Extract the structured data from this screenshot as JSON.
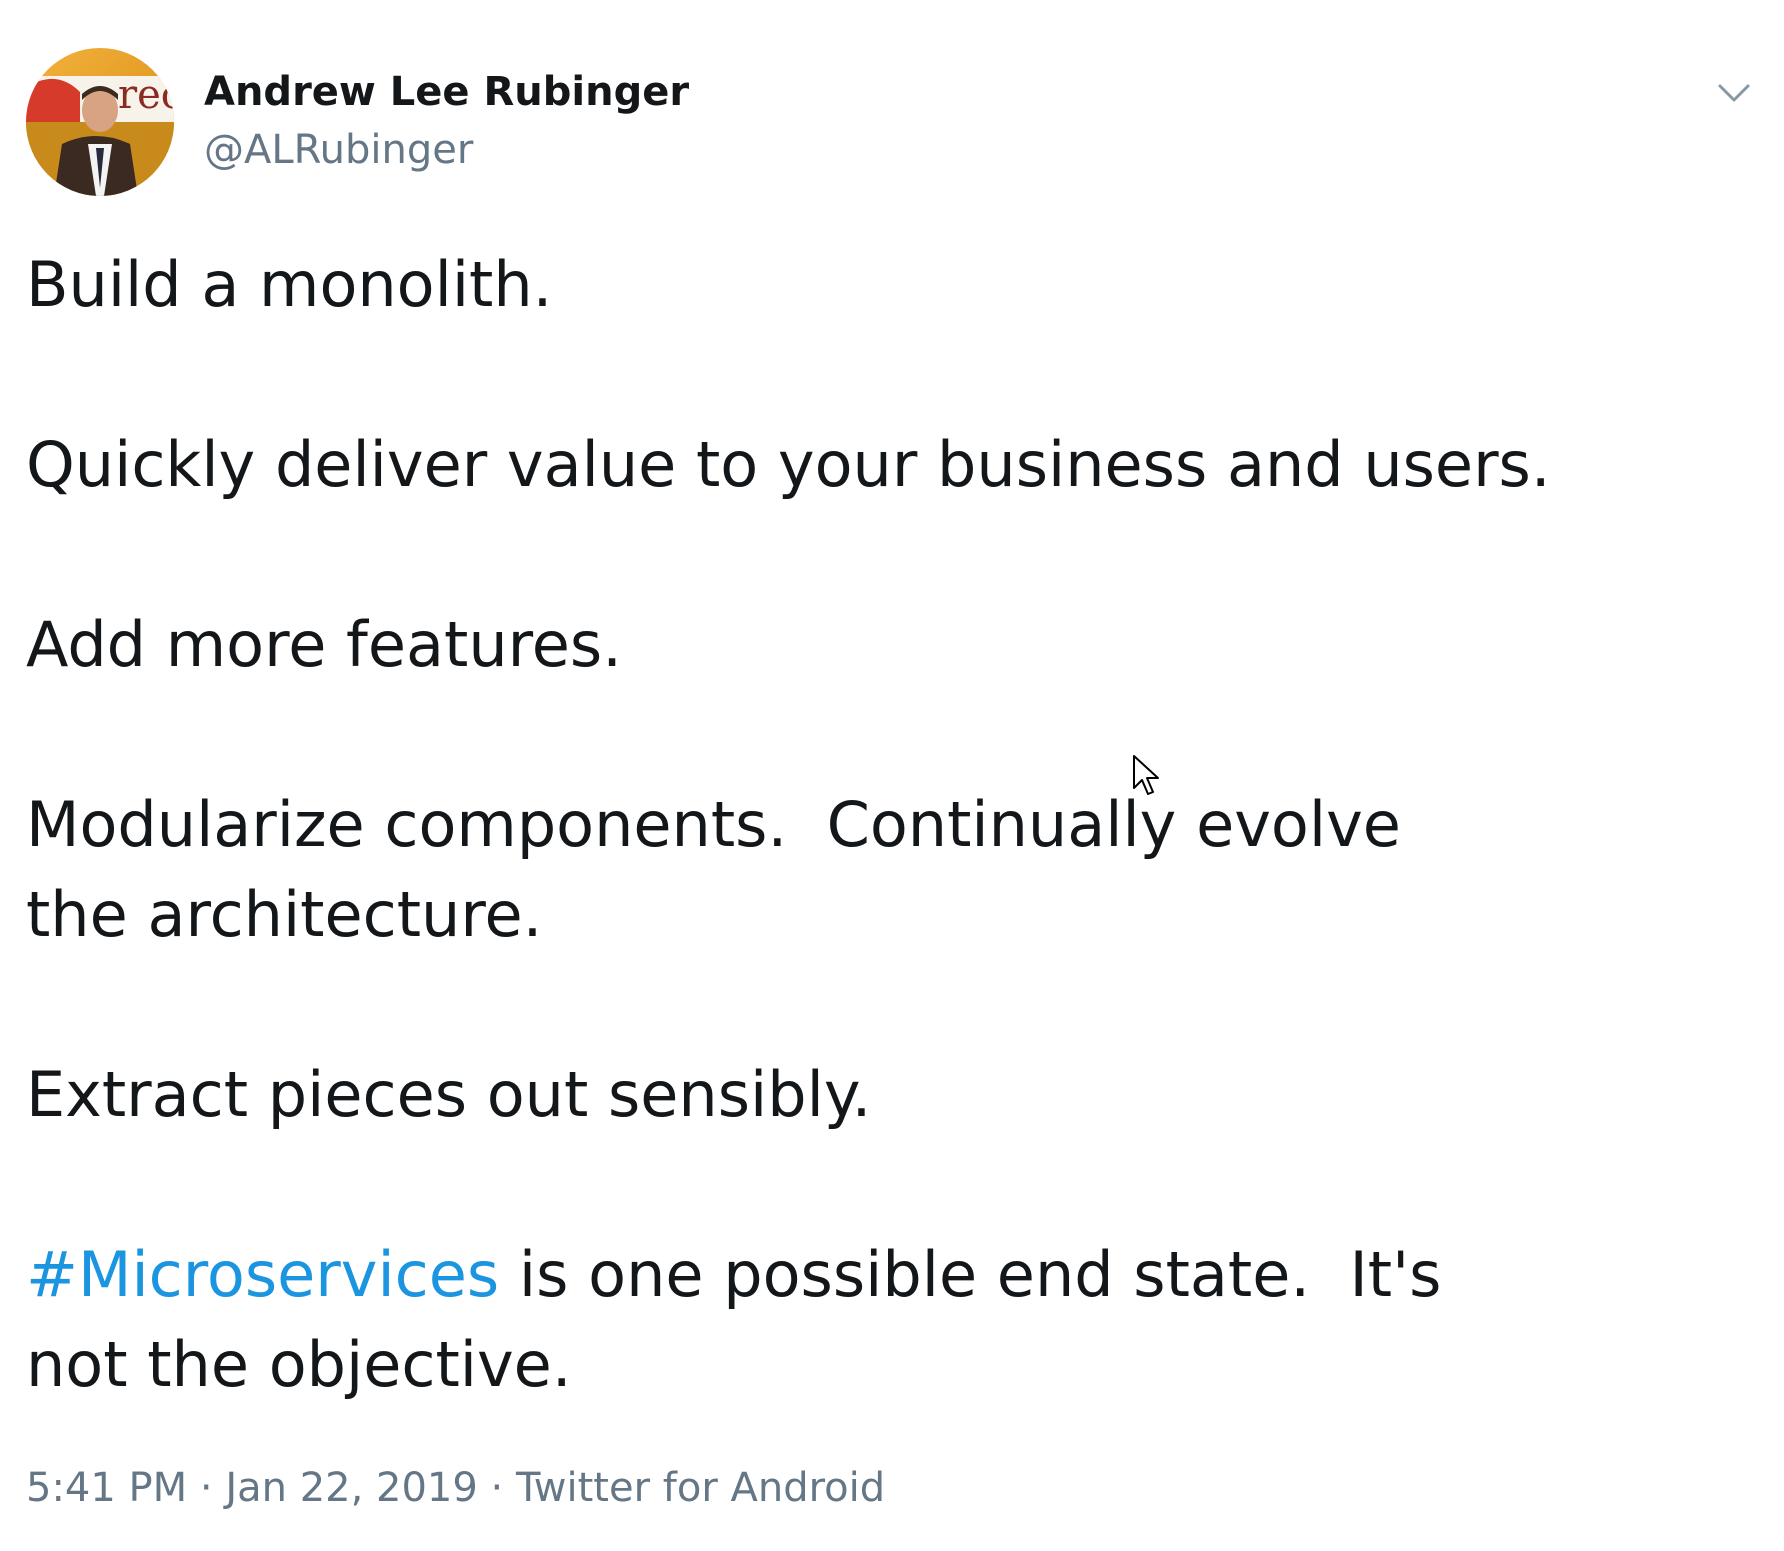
{
  "author": {
    "display_name": "Andrew Lee Rubinger",
    "handle": "@ALRubinger",
    "avatar_icon": "profile-photo"
  },
  "menu": {
    "caret_icon": "chevron-down-icon"
  },
  "tweet": {
    "paragraphs": [
      "Build a monolith.",
      "Quickly deliver value to your business and users.",
      "Add more features.",
      "Modularize components.  Continually evolve the architecture.",
      "Extract pieces out sensibly."
    ],
    "hashtag": "#Microservices",
    "last_paragraph_rest": " is one possible end state.  It's not the objective."
  },
  "meta": {
    "time": "5:41 PM",
    "separator": " · ",
    "date": "Jan 22, 2019",
    "source": "Twitter for Android"
  },
  "colors": {
    "text": "#14171a",
    "secondary": "#657786",
    "link": "#1b95e0"
  }
}
